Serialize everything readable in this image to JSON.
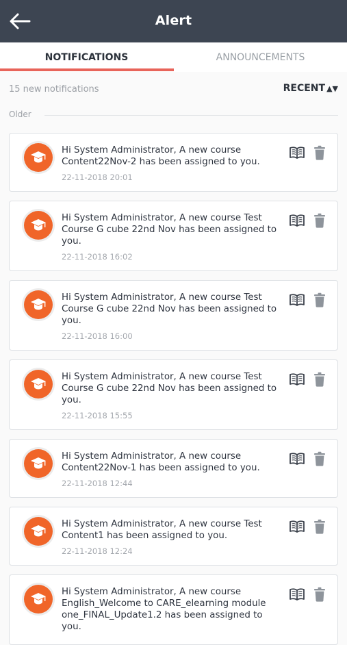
{
  "header": {
    "title": "Alert",
    "back_icon": "arrow-left-icon"
  },
  "tabs": [
    {
      "label": "NOTIFICATIONS",
      "active": true
    },
    {
      "label": "ANNOUNCEMENTS",
      "active": false
    }
  ],
  "summary": "15 new notifications",
  "sort": {
    "label": "RECENT",
    "icon": "sort-updown-icon"
  },
  "section_label": "Older",
  "colors": {
    "header": "#3d4552",
    "accent": "#e8645a",
    "avatar": "#f06529"
  },
  "notifications": [
    {
      "message": "Hi System Administrator, A new course Content22Nov-2 has been assigned to you.",
      "time": "22-11-2018 20:01"
    },
    {
      "message": "Hi System Administrator, A new course Test Course G cube 22nd Nov has been assigned to you.",
      "time": "22-11-2018 16:02"
    },
    {
      "message": "Hi System Administrator, A new course Test Course G cube 22nd Nov has been assigned to you.",
      "time": "22-11-2018 16:00"
    },
    {
      "message": "Hi System Administrator, A new course Test Course G cube 22nd Nov has been assigned to you.",
      "time": "22-11-2018 15:55"
    },
    {
      "message": "Hi System Administrator, A new course Content22Nov-1 has been assigned to you.",
      "time": "22-11-2018 12:44"
    },
    {
      "message": "Hi System Administrator, A new course Test Content1 has been assigned to you.",
      "time": "22-11-2018 12:24"
    },
    {
      "message": "Hi System Administrator, A new course English_Welcome to CARE_elearning module one_FINAL_Update1.2 has been assigned to you.",
      "time": ""
    }
  ]
}
